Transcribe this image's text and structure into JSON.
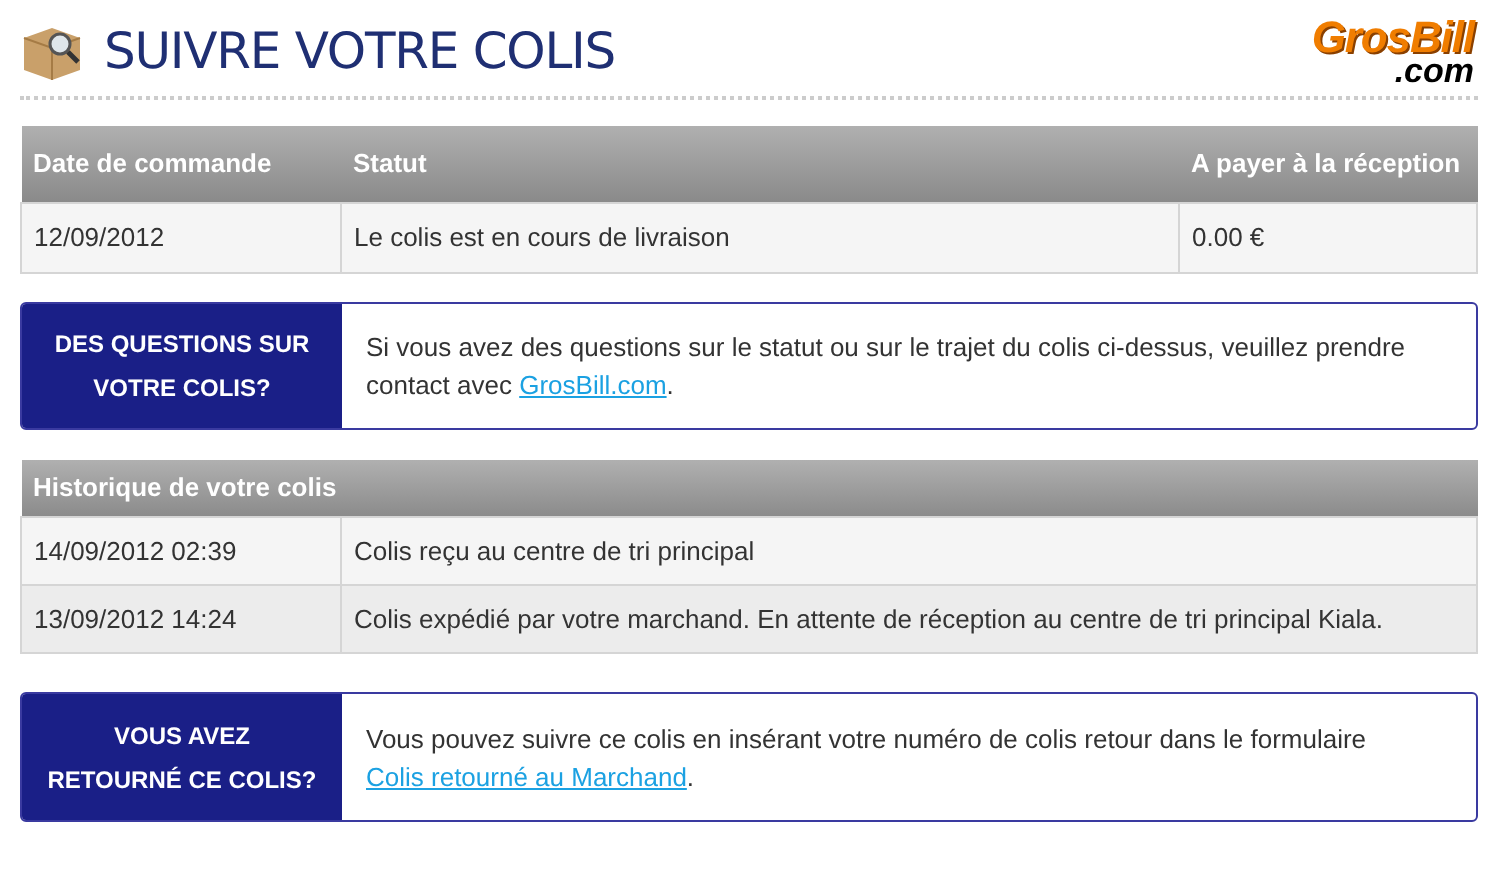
{
  "header": {
    "title": "SUIVRE VOTRE COLIS",
    "logo": {
      "brand": "GrosBill",
      "domain": ".com"
    }
  },
  "order_table": {
    "columns": [
      "Date de commande",
      "Statut",
      "A payer à la réception"
    ],
    "rows": [
      [
        "12/09/2012",
        "Le colis est en cours de livraison",
        "0.00 €"
      ]
    ]
  },
  "questions_box": {
    "label": "DES QUESTIONS SUR VOTRE COLIS?",
    "text": "Si vous avez des questions sur le statut ou sur le trajet du colis ci-dessus, veuillez prendre contact avec ",
    "link": "GrosBill.com",
    "after": "."
  },
  "history_table": {
    "title": "Historique de votre colis",
    "rows": [
      [
        "14/09/2012 02:39",
        "Colis reçu au centre de tri principal"
      ],
      [
        "13/09/2012 14:24",
        "Colis expédié par votre marchand. En attente de réception au centre de tri principal Kiala."
      ]
    ]
  },
  "return_box": {
    "label": "VOUS AVEZ RETOURNÉ CE COLIS?",
    "text": "Vous pouvez suivre ce colis en insérant votre numéro de colis retour dans le formulaire ",
    "link": "Colis retourné au Marchand",
    "after": "."
  }
}
